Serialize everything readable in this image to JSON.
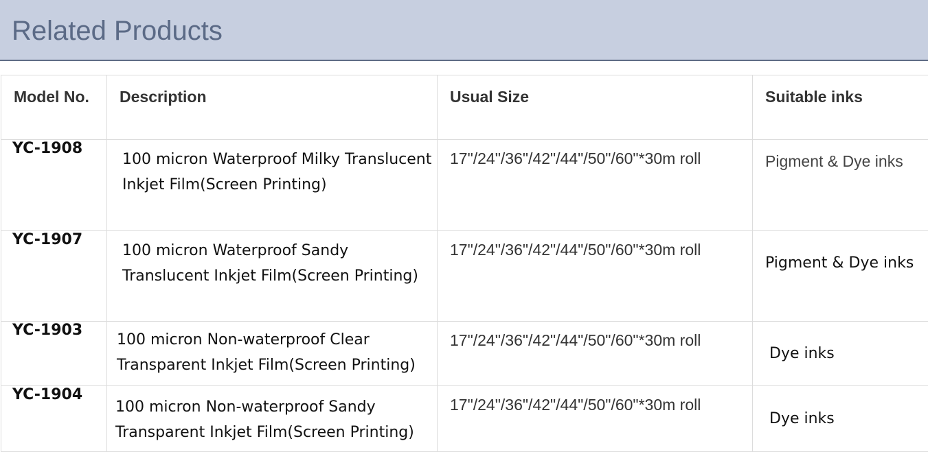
{
  "section": {
    "title": "Related Products"
  },
  "table": {
    "headers": {
      "model": "Model No.",
      "description": "Description",
      "size": "Usual Size",
      "inks": "Suitable inks"
    },
    "rows": [
      {
        "model": "YC-1908",
        "description": "100 micron Waterproof Milky Translucent Inkjet Film(Screen Printing)",
        "size": "17\"/24\"/36\"/42\"/44\"/50\"/60\"*30m roll",
        "inks": "Pigment & Dye inks"
      },
      {
        "model": "YC-1907",
        "description": "100 micron Waterproof Sandy Translucent Inkjet Film(Screen Printing)",
        "size": "17\"/24\"/36\"/42\"/44\"/50\"/60\"*30m roll",
        "inks": "Pigment & Dye inks"
      },
      {
        "model": "YC-1903",
        "description": "100 micron Non-waterproof Clear Transparent Inkjet Film(Screen Printing)",
        "size": "17\"/24\"/36\"/42\"/44\"/50\"/60\"*30m roll",
        "inks": "Dye inks"
      },
      {
        "model": "YC-1904",
        "description": "100 micron Non-waterproof Sandy Transparent Inkjet Film(Screen Printing)",
        "size": "17\"/24\"/36\"/42\"/44\"/50\"/60\"*30m roll",
        "inks": "Dye inks"
      }
    ]
  }
}
